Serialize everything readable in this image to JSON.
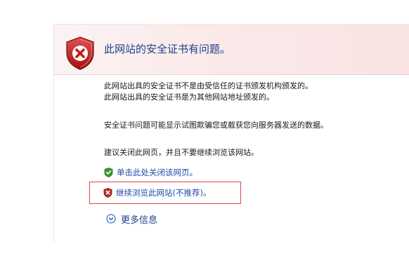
{
  "dialog": {
    "title": "此网站的安全证书有问题。",
    "messages": {
      "line1": "此网站出具的安全证书不是由受信任的证书颁发机构颁发的。",
      "line2": "此网站出具的安全证书是为其他网站地址颁发的。",
      "line3": "安全证书问题可能显示试图欺骗您或截获您向服务器发送的数据。",
      "line4": "建议关闭此网页，并且不要继续浏览该网站。"
    },
    "links": {
      "close_page": "单击此处关闭该网页。",
      "continue": "继续浏览此网站(不推荐)。",
      "more_info": "更多信息"
    },
    "icons": {
      "header": "shield-error-icon",
      "close_page": "green-shield-check-icon",
      "continue": "red-shield-x-icon",
      "more_info": "chevron-down-circle-icon"
    },
    "colors": {
      "title": "#1f3f8c",
      "link": "#1f4aa8",
      "highlight_border": "#d64a4a",
      "header_band": "#fbeaea"
    }
  }
}
